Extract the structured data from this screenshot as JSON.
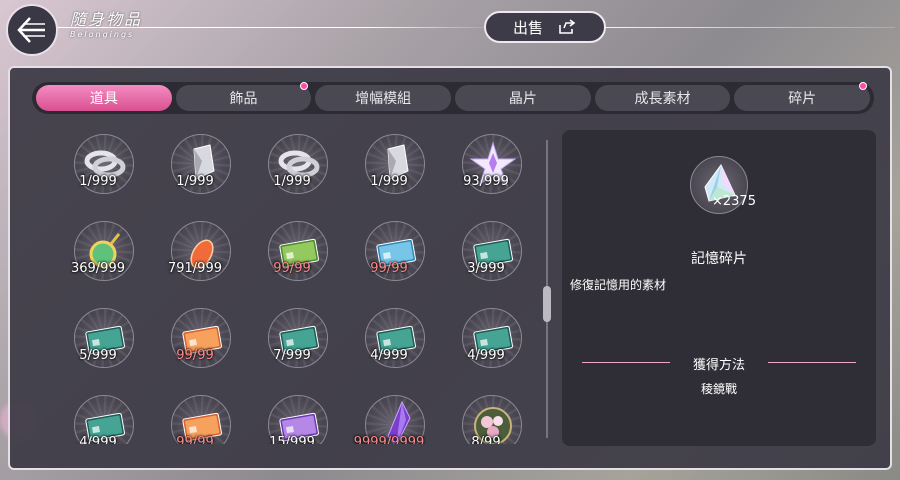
{
  "header": {
    "title": "隨身物品",
    "subtitle": "Belongings",
    "sell_label": "出售"
  },
  "tabs": [
    {
      "label": "道具",
      "active": true,
      "badge": false
    },
    {
      "label": "飾品",
      "active": false,
      "badge": true
    },
    {
      "label": "增幅模組",
      "active": false,
      "badge": false
    },
    {
      "label": "晶片",
      "active": false,
      "badge": false
    },
    {
      "label": "成長素材",
      "active": false,
      "badge": false
    },
    {
      "label": "碎片",
      "active": false,
      "badge": true
    }
  ],
  "items": [
    {
      "count": "1/999",
      "icon": "silver-ring-icon",
      "red": false
    },
    {
      "count": "1/999",
      "icon": "silver-crystal-icon",
      "red": false
    },
    {
      "count": "1/999",
      "icon": "silver-ring-icon",
      "red": false
    },
    {
      "count": "1/999",
      "icon": "silver-crystal-icon",
      "red": false
    },
    {
      "count": "93/999",
      "icon": "star-crystal-icon",
      "red": false
    },
    {
      "count": "369/999",
      "icon": "pendant-icon",
      "red": false
    },
    {
      "count": "791/999",
      "icon": "orange-gem-icon",
      "red": false
    },
    {
      "count": "99/99",
      "icon": "green-card-icon",
      "red": true
    },
    {
      "count": "99/99",
      "icon": "blue-card-icon",
      "red": true
    },
    {
      "count": "3/999",
      "icon": "teal-card-icon",
      "red": false
    },
    {
      "count": "5/999",
      "icon": "teal-card-icon",
      "red": false
    },
    {
      "count": "99/99",
      "icon": "orange-card-icon",
      "red": true
    },
    {
      "count": "7/999",
      "icon": "teal-card-icon",
      "red": false
    },
    {
      "count": "4/999",
      "icon": "teal-card-icon",
      "red": false
    },
    {
      "count": "4/999",
      "icon": "teal-card-icon",
      "red": false
    },
    {
      "count": "4/999",
      "icon": "teal-card-icon",
      "red": false
    },
    {
      "count": "99/99",
      "icon": "orange-card-icon",
      "red": true
    },
    {
      "count": "15/999",
      "icon": "purple-card-icon",
      "red": false
    },
    {
      "count": "9999/9999",
      "icon": "purple-shard-icon",
      "red": true
    },
    {
      "count": "8/99",
      "icon": "flower-emblem-icon",
      "red": false
    }
  ],
  "detail": {
    "quantity": "×2375",
    "name": "記憶碎片",
    "description": "修復記憶用的素材",
    "acquire_title": "獲得方法",
    "acquire_source": "稜鏡戰",
    "icon": "memory-shard-icon"
  },
  "colors": {
    "accent_pink": "#e8609f",
    "panel_bg": "#3e3c46",
    "maxed_count": "#ff8a8a"
  }
}
